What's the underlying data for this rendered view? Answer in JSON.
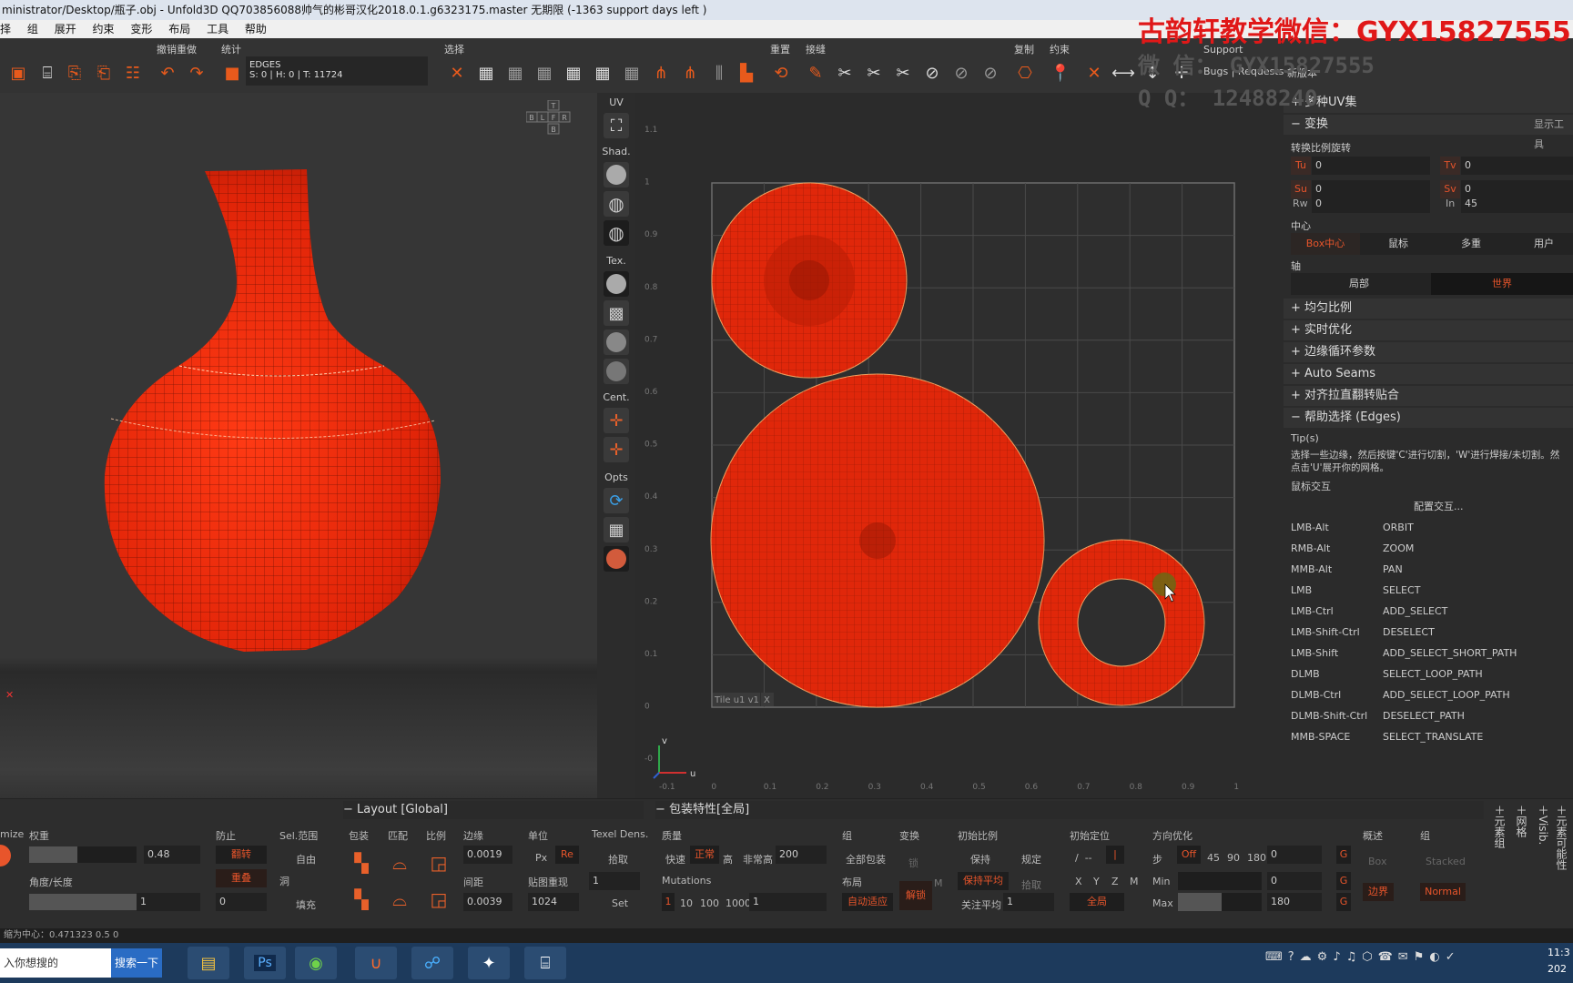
{
  "window": {
    "title": "ministrator/Desktop/瓶子.obj - Unfold3D QQ703856088帅气的彬哥汉化2018.0.1.g6323175.master 无期限 (-1363 support days left )"
  },
  "menu": [
    "择",
    "组",
    "展开",
    "约束",
    "变形",
    "布局",
    "工具",
    "帮助"
  ],
  "watermark": {
    "line1": "古韵轩教学微信：GYX15827555",
    "line2": "微 信： GYX15827555",
    "line3": "Q Q： 12488240"
  },
  "toolbar": {
    "groups": {
      "undo": "撤销重做",
      "stats": "统计",
      "select": "选择",
      "reset": "重置",
      "seam": "接缝",
      "copy": "复制",
      "constrain": "约束",
      "support": "Support"
    },
    "mode": "EDGES",
    "stats_line": "S: 0 | H: 0 | T: 11724",
    "bugs": "Bugs | Requests",
    "newver": "新版本"
  },
  "viewport3d": {
    "nav_labels": [
      "T",
      "B",
      "L",
      "F",
      "R",
      "B"
    ]
  },
  "view_sidebar": {
    "uv": "UV",
    "shad": "Shad.",
    "tex": "Tex.",
    "cent": "Cent.",
    "opts": "Opts"
  },
  "uv_view": {
    "tile_label": "Tile u1 v1",
    "tile_close": "X",
    "axis_v": "v",
    "axis_u": "u",
    "y_ticks": [
      "1.1",
      "1",
      "0.9",
      "0.8",
      "0.7",
      "0.6",
      "0.5",
      "0.4",
      "0.3",
      "0.2",
      "0.1",
      "0",
      "-0"
    ],
    "x_ticks": [
      "-0.1",
      "0",
      "0.1",
      "0.2",
      "0.3",
      "0.4",
      "0.5",
      "0.6",
      "0.7",
      "0.8",
      "0.9",
      "1"
    ]
  },
  "right_panel": {
    "multi_uv": "多种UV集",
    "transform": "变换",
    "show_tools": "显示工具",
    "scale_rot": "转换比例旋转",
    "fields": {
      "tu": "Tu",
      "tu_val": "0",
      "tv": "Tv",
      "tv_val": "0",
      "su": "Su",
      "su_val": "0",
      "sv": "Sv",
      "sv_val": "0",
      "rw": "Rw",
      "rw_val": "0",
      "in": "In",
      "in_val": "45"
    },
    "center": "中心",
    "center_opts": [
      "Box中心",
      "鼠标",
      "多重",
      "用户"
    ],
    "axis": "轴",
    "axis_opts": [
      "局部",
      "世界"
    ],
    "sections": [
      "均匀比例",
      "实时优化",
      "边缘循环参数",
      "Auto Seams",
      "对齐拉直翻转贴合"
    ],
    "help_title": "帮助选择 (Edges)",
    "tips_label": "Tip(s)",
    "tips_text1": "选择一些边缘，然后按键'C'进行切割，'W'进行焊接/未切割。然",
    "tips_text2": "点击'U'展开你的网格。",
    "mouse_label": "鼠标交互",
    "config": "配置交互...",
    "bindings": [
      {
        "k": "LMB-Alt",
        "v": "ORBIT"
      },
      {
        "k": "RMB-Alt",
        "v": "ZOOM"
      },
      {
        "k": "MMB-Alt",
        "v": "PAN"
      },
      {
        "k": "LMB",
        "v": "SELECT"
      },
      {
        "k": "LMB-Ctrl",
        "v": "ADD_SELECT"
      },
      {
        "k": "LMB-Shift-Ctrl",
        "v": "DESELECT"
      },
      {
        "k": "LMB-Shift",
        "v": "ADD_SELECT_SHORT_PATH"
      },
      {
        "k": "DLMB",
        "v": "SELECT_LOOP_PATH"
      },
      {
        "k": "DLMB-Ctrl",
        "v": "ADD_SELECT_LOOP_PATH"
      },
      {
        "k": "DLMB-Shift-Ctrl",
        "v": "DESELECT_PATH"
      },
      {
        "k": "MMB-SPACE",
        "v": "SELECT_TRANSLATE"
      }
    ]
  },
  "bottom": {
    "p1": {
      "optimize": "mize",
      "weight": "权重",
      "weight_val": "0.48",
      "angle": "角度/长度",
      "angle_val": "1",
      "prevent": "防止",
      "flip": "翻转",
      "overlap": "重叠",
      "prevent_val": "0",
      "selrange": "Sel.范围",
      "free": "自由",
      "hole": "洞",
      "fill": "填充"
    },
    "layout": {
      "title": "Layout [Global]",
      "pack": "包装",
      "match": "匹配",
      "ratio": "比例",
      "edge": "边缘",
      "edge_val": "0.0019",
      "spacing": "间距",
      "spacing_val": "0.0039",
      "unit": "单位",
      "px": "Px",
      "re": "Re",
      "tex_res": "贴图重现",
      "tex_res_val": "1",
      "res": "1024",
      "texel": "Texel Dens.",
      "pick": "拾取",
      "set": "Set"
    },
    "pack": {
      "title": "包装特性[全局]",
      "quality": "质量",
      "fast": "快速",
      "normal": "正常",
      "high": "高",
      "vhigh": "非常高",
      "qval": "200",
      "mutations": "Mutations",
      "m_opts": [
        "1",
        "10",
        "100",
        "1000"
      ],
      "m_val": "1",
      "group": "组",
      "all_pack": "全部包装",
      "layout": "布局",
      "auto": "自动适应",
      "transform": "变换",
      "lock": "锁",
      "unlock": "解锁",
      "m1": "M",
      "init_scale": "初始比例",
      "keep": "保持",
      "rule": "规定",
      "keep_avg": "保持平均",
      "pick": "拾取",
      "focus_avg": "关注平均",
      "focus_val": "1",
      "init_pos": "初始定位",
      "xyz": [
        "X",
        "Y",
        "Z",
        "M"
      ],
      "all": "全局",
      "dir_opt": "方向优化",
      "step": "步",
      "off": "Off",
      "angles": [
        "45",
        "90",
        "180"
      ],
      "step_val": "0",
      "min": "Min",
      "min_val": "0",
      "max": "Max",
      "max_val": "180",
      "g": "G",
      "overview": "概述",
      "box": "Box",
      "border": "边界",
      "group2": "组",
      "stacked": "Stacked",
      "normal_btn": "Normal",
      "side_tabs": [
        "元素组",
        "网格",
        "Visib.",
        "元素可能性"
      ]
    }
  },
  "statusbar": {
    "text": "缩为中心：0.471323 0.5 0"
  },
  "taskbar": {
    "search_placeholder": "入你想搜的",
    "search_btn": "搜索一下",
    "clock": "11:3",
    "date": "202"
  }
}
